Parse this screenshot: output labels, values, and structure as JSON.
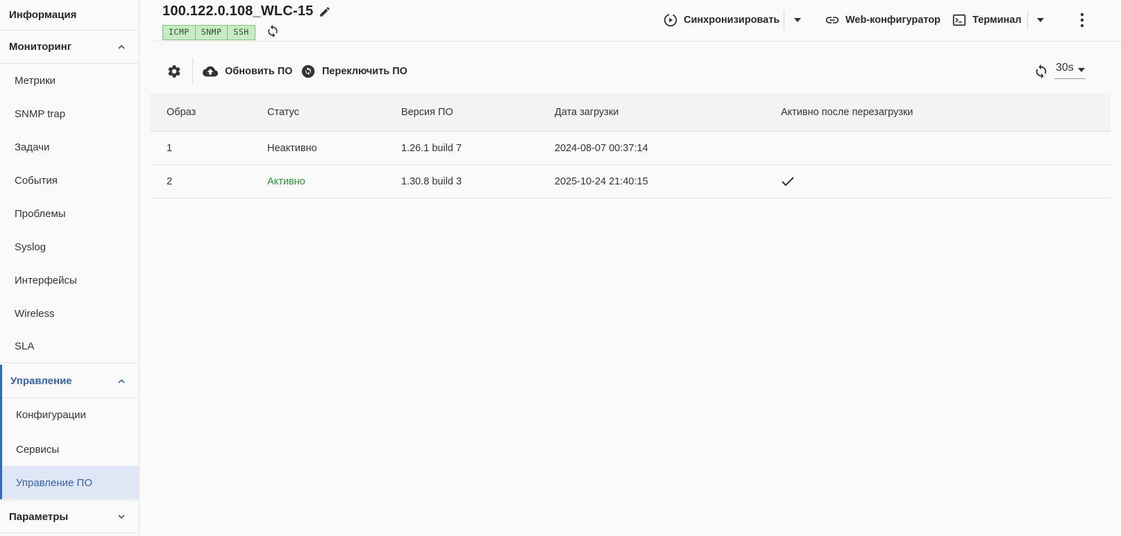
{
  "sidebar": {
    "info": "Информация",
    "monitoring": {
      "label": "Мониторинг",
      "items": [
        "Метрики",
        "SNMP trap",
        "Задачи",
        "События",
        "Проблемы",
        "Syslog",
        "Интерфейсы",
        "Wireless",
        "SLA"
      ]
    },
    "management": {
      "label": "Управление",
      "items": [
        "Конфигурации",
        "Сервисы",
        "Управление ПО"
      ]
    },
    "params": "Параметры"
  },
  "header": {
    "title": "100.122.0.108_WLC-15",
    "tags": [
      "ICMP",
      "SNMP",
      "SSH"
    ],
    "sync_label": "Синхронизировать",
    "web_label": "Web-конфигуратор",
    "terminal_label": "Терминал"
  },
  "toolbar": {
    "update_label": "Обновить ПО",
    "switch_label": "Переключить ПО",
    "interval": "30s"
  },
  "table": {
    "columns": [
      "Образ",
      "Статус",
      "Версия ПО",
      "Дата загрузки",
      "Активно после перезагрузки"
    ],
    "rows": [
      {
        "image": "1",
        "status": "Неактивно",
        "version": "1.26.1 build 7",
        "date": "2024-08-07 00:37:14",
        "active_after_reboot": false
      },
      {
        "image": "2",
        "status": "Активно",
        "version": "1.30.8 build 3",
        "date": "2025-10-24 21:40:15",
        "active_after_reboot": true
      }
    ]
  },
  "colors": {
    "accent": "#3565b8",
    "active_status": "#1f9d2a",
    "tag_bg": "#c7ecc4"
  }
}
